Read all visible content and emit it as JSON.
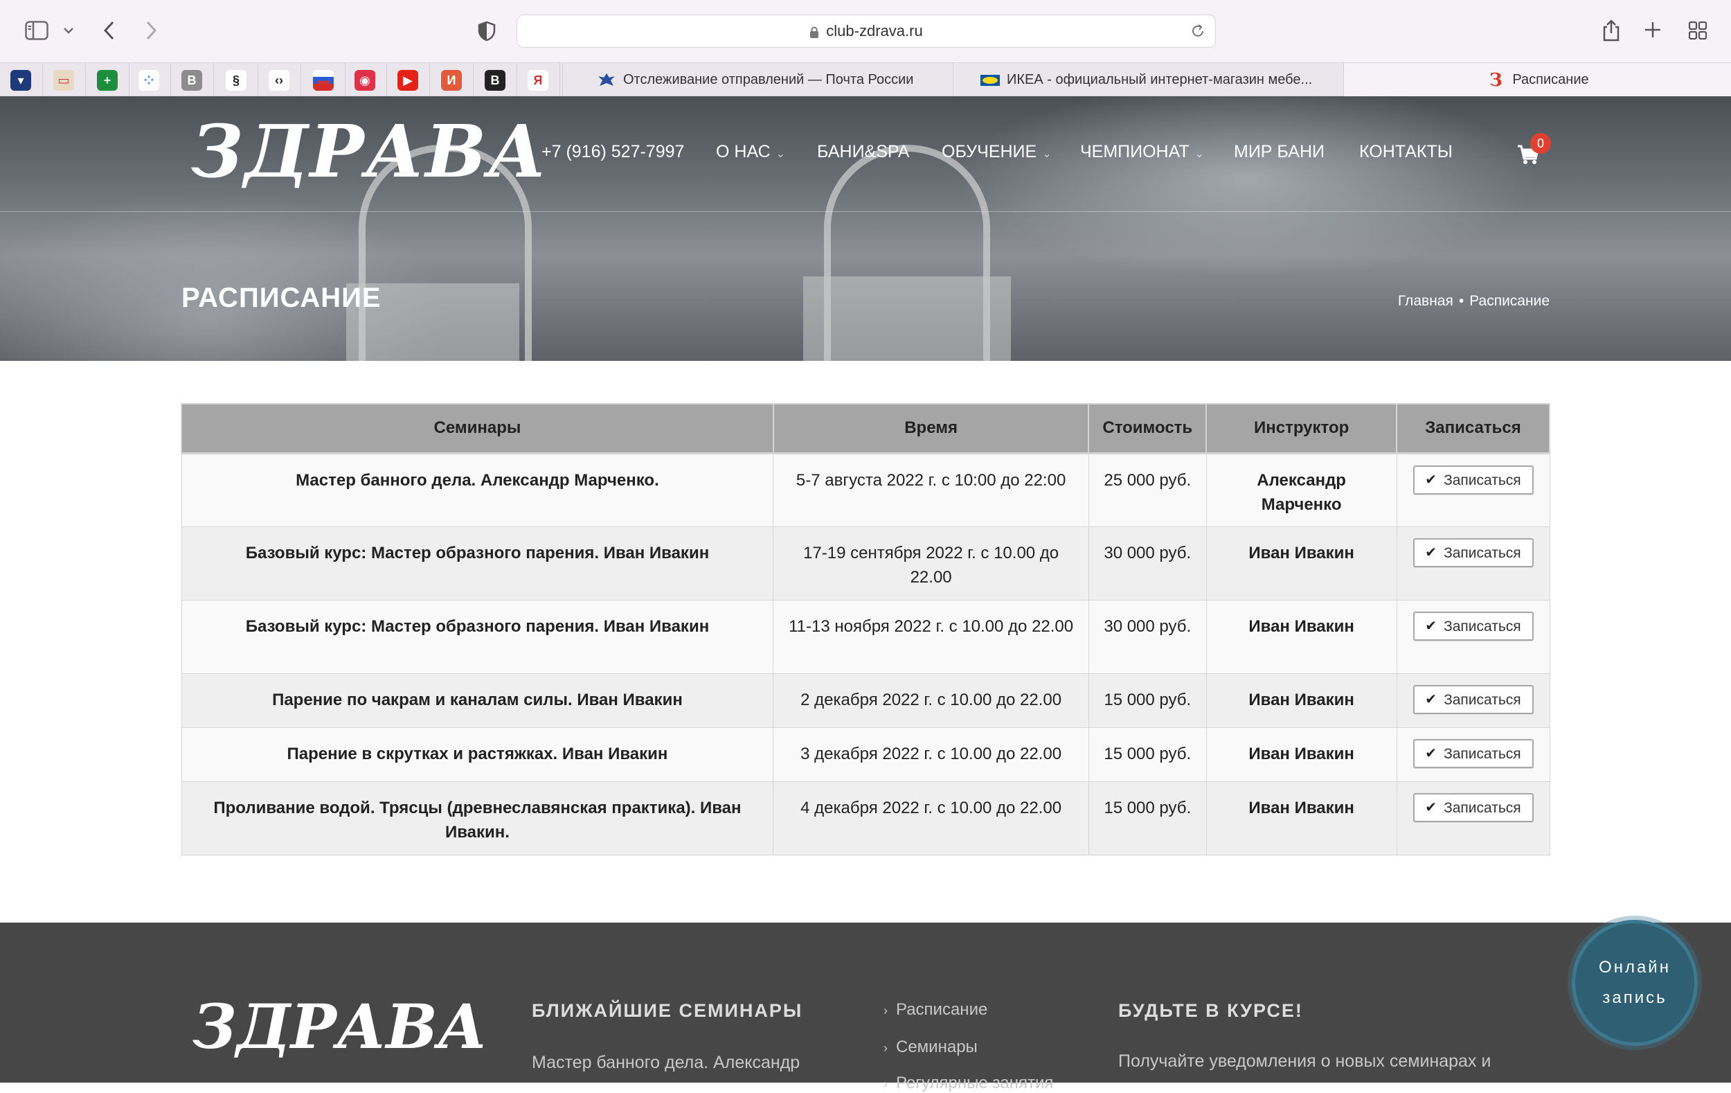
{
  "browser": {
    "url": "club-zdrava.ru",
    "favorites": [
      {
        "icon": "penn-shield-icon",
        "color": "#1f3a7a",
        "glyph": "▾"
      },
      {
        "icon": "mail-icon",
        "color": "#e9d8c2",
        "glyph": "▭"
      },
      {
        "icon": "sheets-plus-icon",
        "color": "#1e8e3e",
        "glyph": "+"
      },
      {
        "icon": "dots-icon",
        "color": "#ffffff",
        "glyph": "⁘"
      },
      {
        "icon": "b-letter-icon",
        "color": "#8c8c8c",
        "glyph": "B"
      },
      {
        "icon": "flame-icon",
        "color": "#ffffff",
        "glyph": "§"
      },
      {
        "icon": "code-icon",
        "color": "#ffffff",
        "glyph": "‹›"
      },
      {
        "icon": "russia-flag-icon",
        "color": "#ffffff",
        "glyph": "▬"
      },
      {
        "icon": "ring-icon",
        "color": "#e0304a",
        "glyph": "◉"
      },
      {
        "icon": "youtube-icon",
        "color": "#e62117",
        "glyph": "▶"
      },
      {
        "icon": "i-letter-icon",
        "color": "#e25c3c",
        "glyph": "И"
      },
      {
        "icon": "b-circle-icon",
        "color": "#222222",
        "glyph": "B"
      },
      {
        "icon": "yandex-icon",
        "color": "#ffffff",
        "glyph": "Я"
      }
    ],
    "tabs": [
      {
        "title": "Отслеживание отправлений — Почта России",
        "icon": "eagle-icon"
      },
      {
        "title": "ИКЕА - официальный интернет-магазин мебе...",
        "icon": "ikea-icon"
      },
      {
        "title": "Расписание",
        "icon": "zdrava-icon",
        "glyph": "З"
      }
    ]
  },
  "site": {
    "logo": "ЗДРАВА",
    "nav": {
      "phone": "+7 (916) 527-7997",
      "about": "О НАС",
      "spa": "БАНИ&SPA",
      "learning": "ОБУЧЕНИЕ",
      "championship": "ЧЕМПИОНАТ",
      "world": "МИР БАНИ",
      "contacts": "КОНТАКТЫ"
    },
    "cart_count": "0",
    "page_title": "РАСПИСАНИЕ",
    "breadcrumb": {
      "home": "Главная",
      "separator": "•",
      "current": "Расписание"
    }
  },
  "table": {
    "headers": [
      "Семинары",
      "Время",
      "Стоимость",
      "Инструктор",
      "Записаться"
    ],
    "enroll_label": "Записаться",
    "rows": [
      {
        "seminar": "Мастер банного дела. Александр Марченко.",
        "time": "5-7 августа 2022 г. с 10:00 до 22:00",
        "price": "25 000 руб.",
        "instructor": "Александр Марченко"
      },
      {
        "seminar": "Базовый курс: Мастер образного парения. Иван Ивакин",
        "time": "17-19 сентября 2022 г. с 10.00 до 22.00",
        "price": "30 000 руб.",
        "instructor": "Иван Ивакин"
      },
      {
        "seminar": "Базовый курс: Мастер образного парения. Иван Ивакин",
        "time": "11-13 ноября 2022 г. с 10.00 до 22.00",
        "price": "30 000 руб.",
        "instructor": "Иван Ивакин"
      },
      {
        "seminar": "Парение по чакрам и каналам силы. Иван Ивакин",
        "time": "2 декабря 2022 г. с 10.00 до 22.00",
        "price": "15 000 руб.",
        "instructor": "Иван Ивакин"
      },
      {
        "seminar": "Парение в скрутках и растяжках. Иван Ивакин",
        "time": "3 декабря 2022 г. с 10.00 до 22.00",
        "price": "15 000 руб.",
        "instructor": "Иван Ивакин"
      },
      {
        "seminar": "Проливание водой. Трясцы (древнеславянская практика). Иван Ивакин.",
        "time": "4 декабря 2022 г. с 10.00 до 22.00",
        "price": "15 000 руб.",
        "instructor": "Иван Ивакин"
      }
    ]
  },
  "footer": {
    "logo": "ЗДРАВА",
    "seminars_heading": "БЛИЖАЙШИЕ СЕМИНАРЫ",
    "seminars_text": "Мастер банного дела. Александр",
    "links": [
      "Расписание",
      "Семинары",
      "Регулярные занятия"
    ],
    "news_heading": "БУДЬТЕ В КУРСЕ!",
    "news_text": "Получайте уведомления о новых семинарах и"
  },
  "online_booking": {
    "line1": "Онлайн",
    "line2": "запись"
  }
}
